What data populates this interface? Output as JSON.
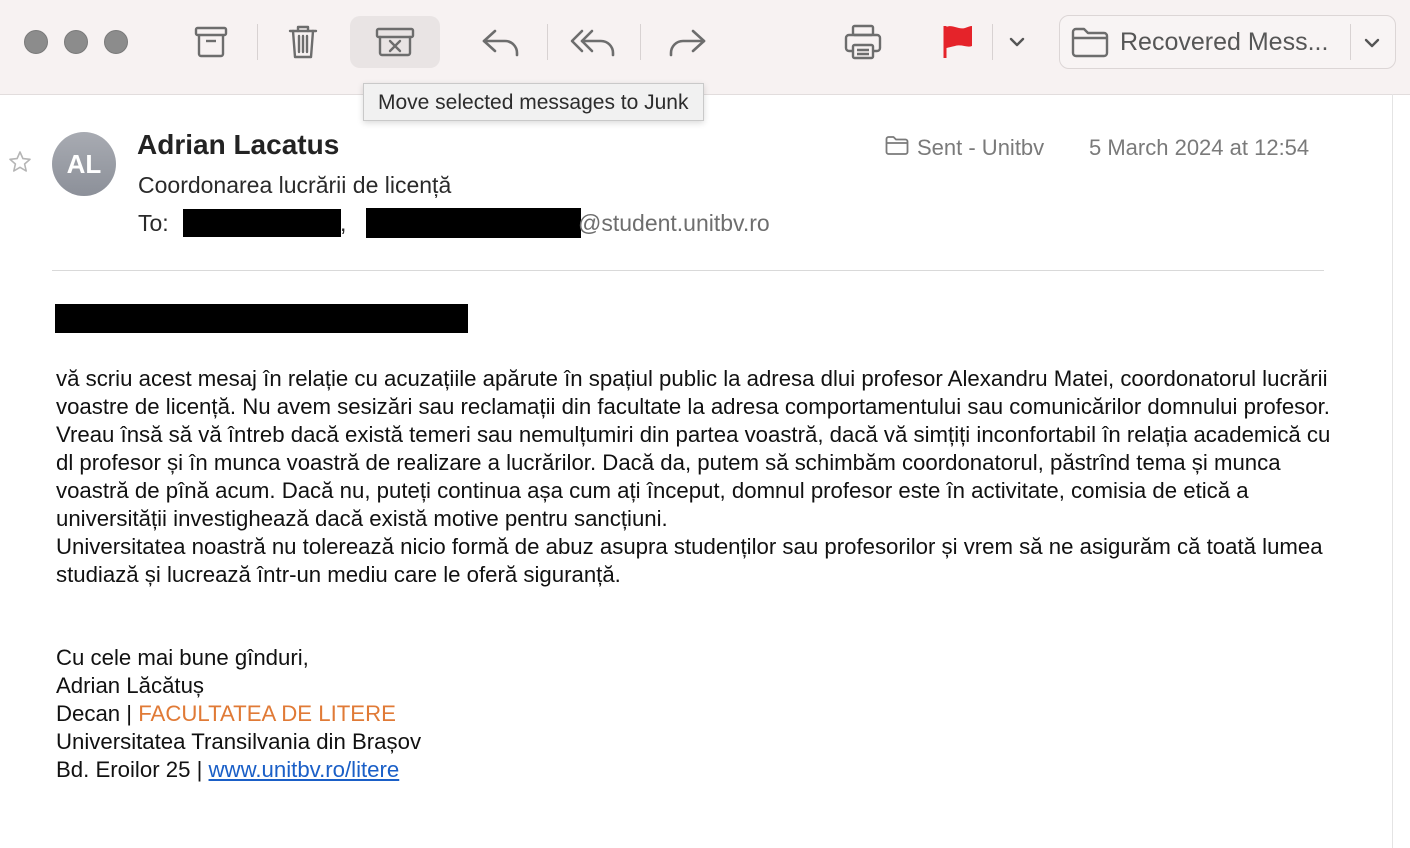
{
  "toolbar": {
    "buttons": [
      "archive-icon",
      "trash-icon",
      "junk-icon",
      "reply-icon",
      "reply-all-icon",
      "forward-icon",
      "print-icon",
      "flag-icon"
    ],
    "mailbox_label": "Recovered Mess...",
    "tooltip": "Move selected messages to Junk",
    "flag_color": "#e5232a"
  },
  "message": {
    "avatar_initials": "AL",
    "sender_name": "Adrian Lacatus",
    "subject": "Coordonarea lucrării de licență",
    "to_label": "To:",
    "to_separator": ",",
    "to_domain": "@student.unitbv.ro",
    "folder": "Sent - Unitbv",
    "date": "5 March 2024 at 12:54"
  },
  "body": {
    "paragraphs": [
      "vă scriu acest mesaj în relație cu acuzațiile apărute în spațiul public la adresa dlui profesor Alexandru Matei, coordonatorul lucrării voastre de licență. Nu avem sesizări sau reclamații din facultate la adresa comportamentului sau comunicărilor domnului profesor.",
      "Vreau însă să vă întreb dacă există temeri sau nemulțumiri din partea voastră, dacă vă simțiți inconfortabil în relația academică cu dl profesor și în munca voastră de realizare a lucrărilor. Dacă da, putem să schimbăm coordonatorul, păstrînd tema și munca voastră de pînă acum. Dacă nu, puteți continua așa cum ați început, domnul profesor este în activitate, comisia de etică a universității investighează dacă există motive pentru sancțiuni.",
      "Universitatea noastră nu tolerează nicio formă de abuz asupra studenților sau profesorilor și vrem să ne asigurăm că toată lumea studiază și lucrează într-un mediu care le oferă siguranță."
    ]
  },
  "signature": {
    "closing": "Cu cele mai bune gînduri,",
    "name": "Adrian Lăcătuș",
    "role_prefix": "Decan | ",
    "faculty": "FACULTATEA DE LITERE",
    "university": "Universitatea Transilvania din Brașov",
    "address_prefix": "Bd. Eroilor 25 | ",
    "website": "www.unitbv.ro/litere",
    "faculty_color": "#e07a36",
    "link_color": "#1a5fc7"
  }
}
